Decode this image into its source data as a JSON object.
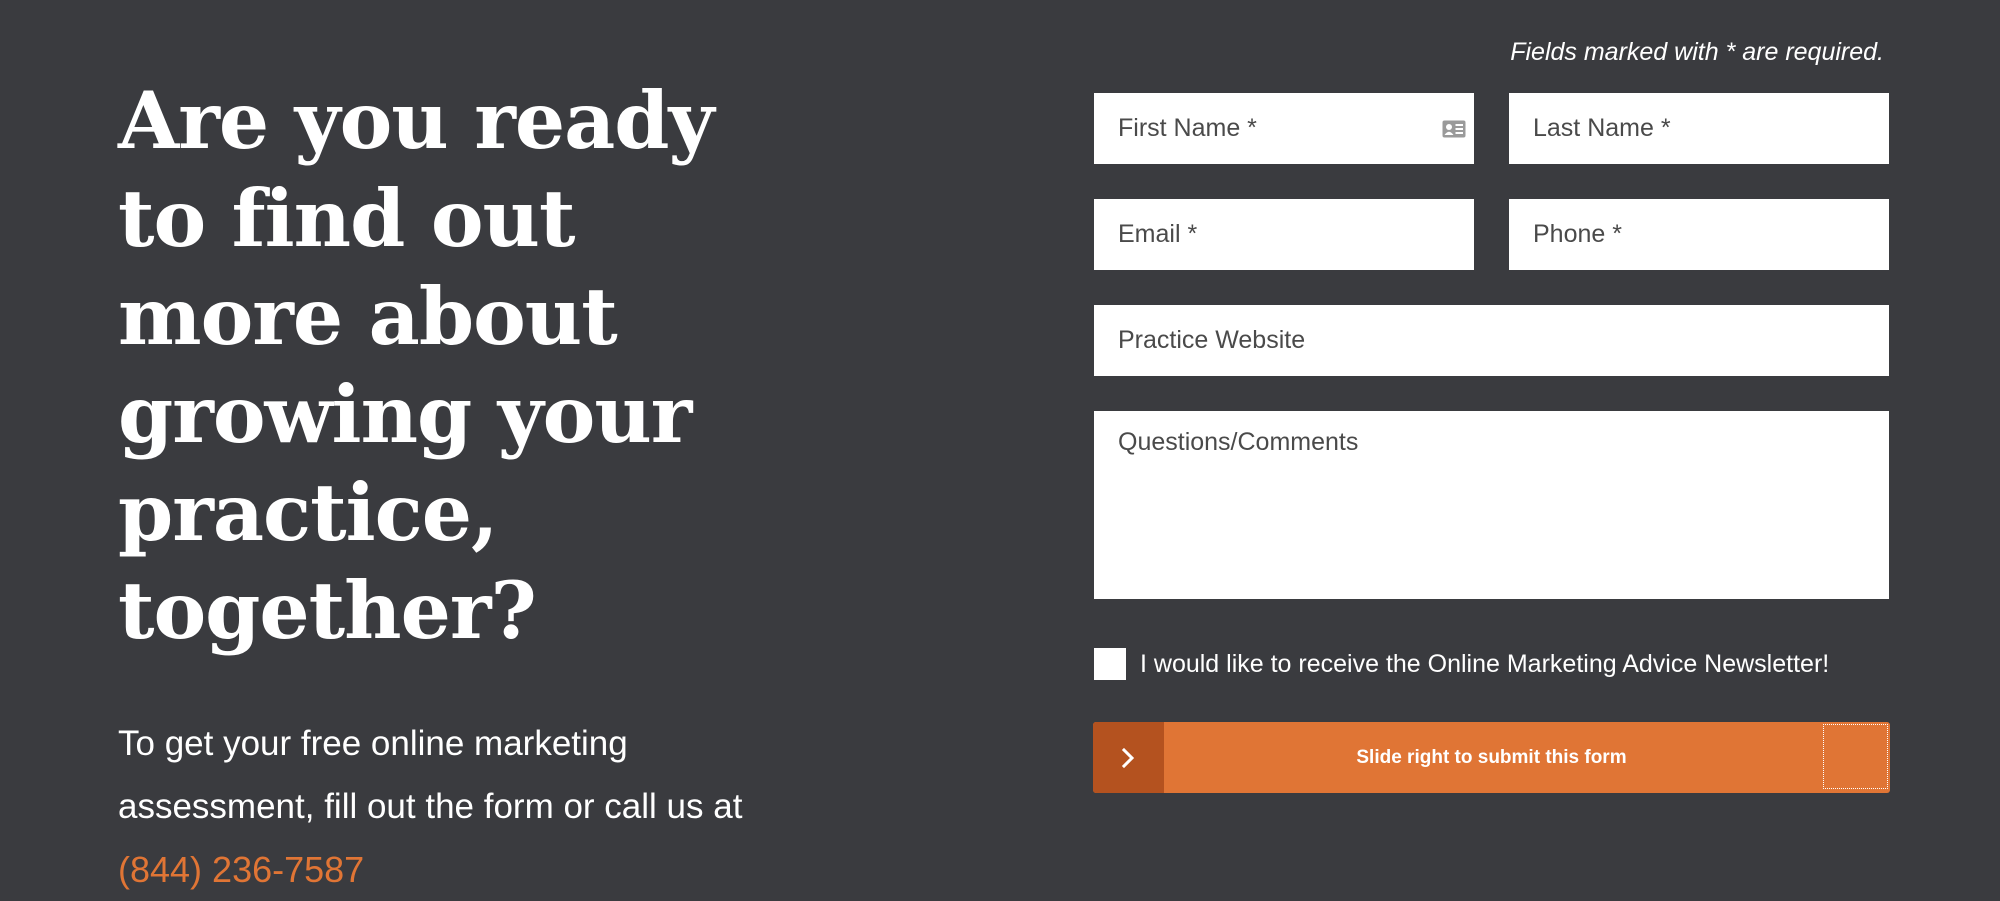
{
  "hero": {
    "headline": "Are you ready to find out more about growing your practice, together?",
    "subtext": "To get your free online marketing assessment, fill out the form or call us at",
    "phone": "(844) 236-7587"
  },
  "form": {
    "required_note": "Fields marked with * are required.",
    "first_name_placeholder": "First Name *",
    "last_name_placeholder": "Last Name *",
    "email_placeholder": "Email *",
    "phone_placeholder": "Phone *",
    "website_placeholder": "Practice Website",
    "comments_placeholder": "Questions/Comments",
    "newsletter_label": "I would like to receive the Online Marketing Advice Newsletter!",
    "submit_slider_label": "Slide right to submit this form",
    "autofill_icon": "contact-card-icon",
    "slider_icon": "chevron-right-icon"
  },
  "colors": {
    "background": "#3a3b3f",
    "accent": "#e07535",
    "accent_dark": "#b4521f"
  }
}
